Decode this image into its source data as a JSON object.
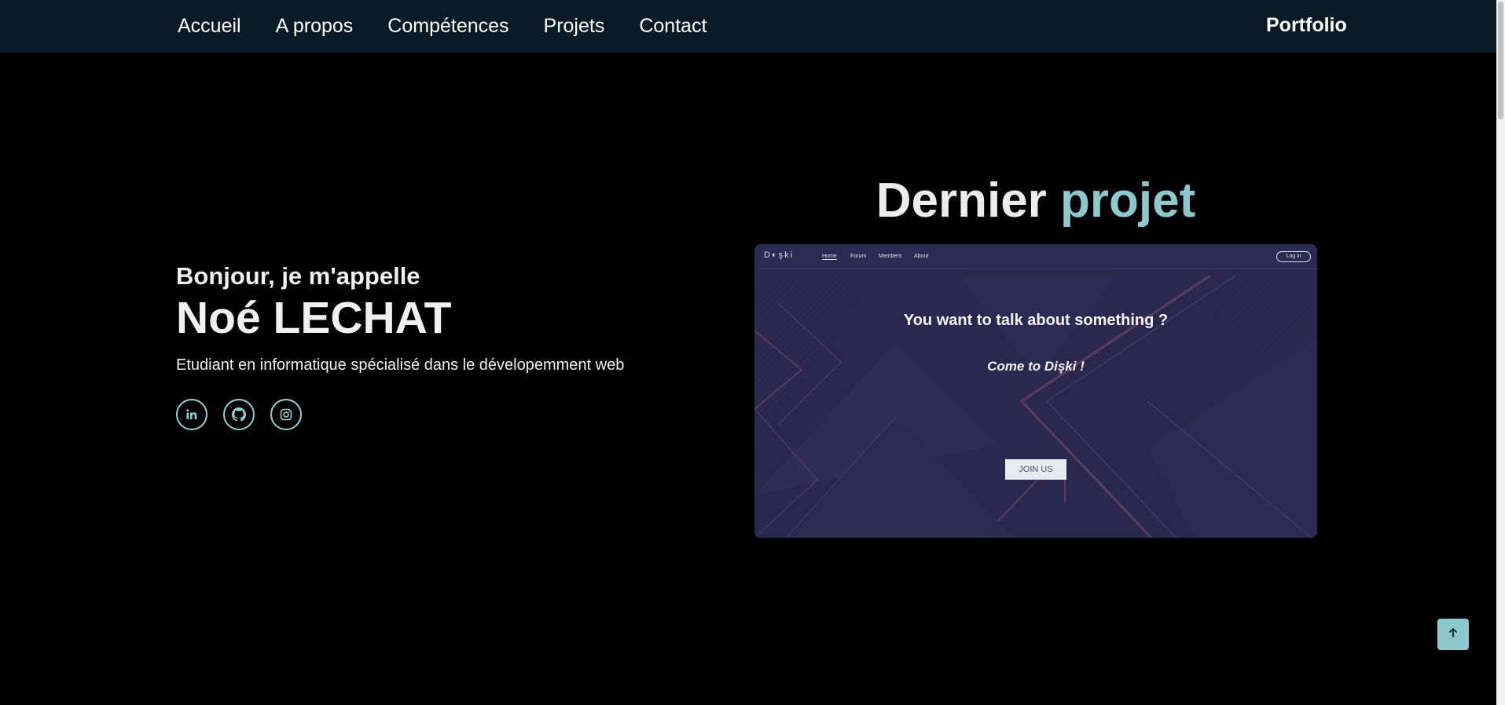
{
  "nav": {
    "links": [
      "Accueil",
      "A propos",
      "Compétences",
      "Projets",
      "Contact"
    ],
    "brand": "Portfolio"
  },
  "intro": {
    "greeting": "Bonjour, je m'appelle",
    "name": "Noé LECHAT",
    "subtitle": "Etudiant en informatique spécialisé dans le dévelopemment web",
    "socials": [
      {
        "icon": "linkedin-icon"
      },
      {
        "icon": "github-icon"
      },
      {
        "icon": "instagram-icon"
      }
    ]
  },
  "project": {
    "title_part1": "Dernier",
    "title_part2": "projet",
    "preview": {
      "logo": "D◐şki",
      "nav": [
        "Home",
        "Forum",
        "Members",
        "About"
      ],
      "login": "Log in",
      "headline": "You want to talk about something ?",
      "tagline": "Come to Dişki !",
      "join": "JOIN US"
    }
  },
  "back_to_top": {
    "icon": "arrow-up-icon"
  },
  "colors": {
    "nav_bg": "#0a1a27",
    "page_bg": "#000000",
    "accent": "#8dc9cc",
    "preview_bg": "#2a284e"
  }
}
